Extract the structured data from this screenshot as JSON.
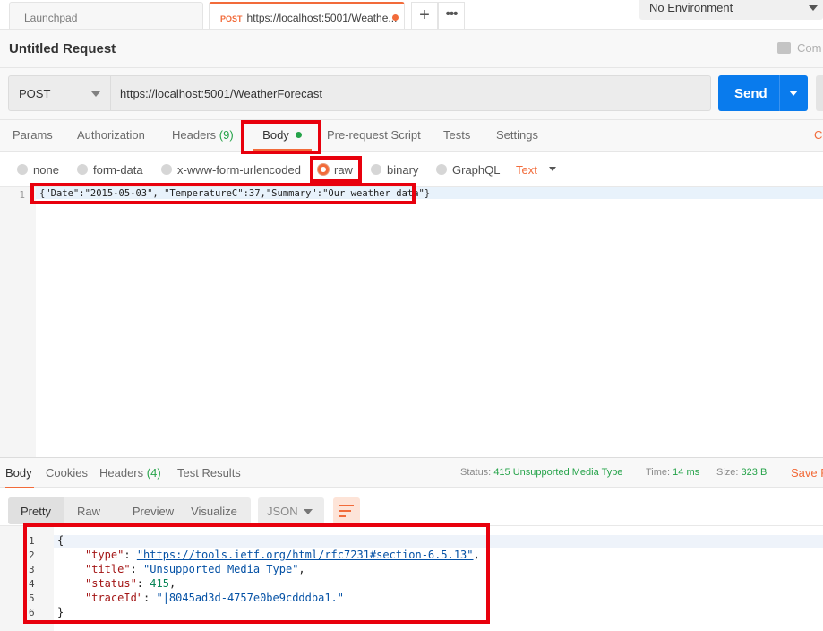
{
  "tabs": {
    "launchpad": "Launchpad",
    "request_method": "POST",
    "request_title": "https://localhost:5001/Weathe...",
    "add_label": "+"
  },
  "environment": "No Environment",
  "request": {
    "title": "Untitled Request",
    "comments_label": "Com",
    "method": "POST",
    "url": "https://localhost:5001/WeatherForecast",
    "send_label": "Send"
  },
  "request_tabs": {
    "params": "Params",
    "authorization": "Authorization",
    "headers": "Headers",
    "headers_count": "(9)",
    "body": "Body",
    "pre_request": "Pre-request Script",
    "tests": "Tests",
    "settings": "Settings",
    "cookies_code": "Co"
  },
  "body_types": {
    "none": "none",
    "form_data": "form-data",
    "urlencoded": "x-www-form-urlencoded",
    "raw": "raw",
    "binary": "binary",
    "graphql": "GraphQL",
    "format": "Text"
  },
  "request_body": {
    "line_number": "1",
    "code": "{\"Date\":\"2015-05-03\", \"TemperatureC\":37,\"Summary\":\"Our weather data\"}"
  },
  "response_tabs": {
    "body": "Body",
    "cookies": "Cookies",
    "headers": "Headers",
    "headers_count": "(4)",
    "test_results": "Test Results"
  },
  "response_meta": {
    "status_label": "Status:",
    "status_value": "415 Unsupported Media Type",
    "time_label": "Time:",
    "time_value": "14 ms",
    "size_label": "Size:",
    "size_value": "323 B",
    "save_label": "Save R"
  },
  "response_view": {
    "pretty": "Pretty",
    "raw": "Raw",
    "preview": "Preview",
    "visualize": "Visualize",
    "format": "JSON"
  },
  "response_body": {
    "line_numbers": [
      "1",
      "2",
      "3",
      "4",
      "5",
      "6"
    ],
    "open_brace": "{",
    "close_brace": "}",
    "type_key": "\"type\"",
    "type_value": "\"https://tools.ietf.org/html/rfc7231#section-6.5.13\"",
    "title_key": "\"title\"",
    "title_value": "\"Unsupported Media Type\"",
    "status_key": "\"status\"",
    "status_value": "415",
    "traceid_key": "\"traceId\"",
    "traceid_value": "\"|8045ad3d-4757e0be9cdddba1.\""
  },
  "colors": {
    "accent": "#f26b3a",
    "send": "#097bed",
    "success": "#26a34a",
    "annotation": "#e8000d"
  }
}
